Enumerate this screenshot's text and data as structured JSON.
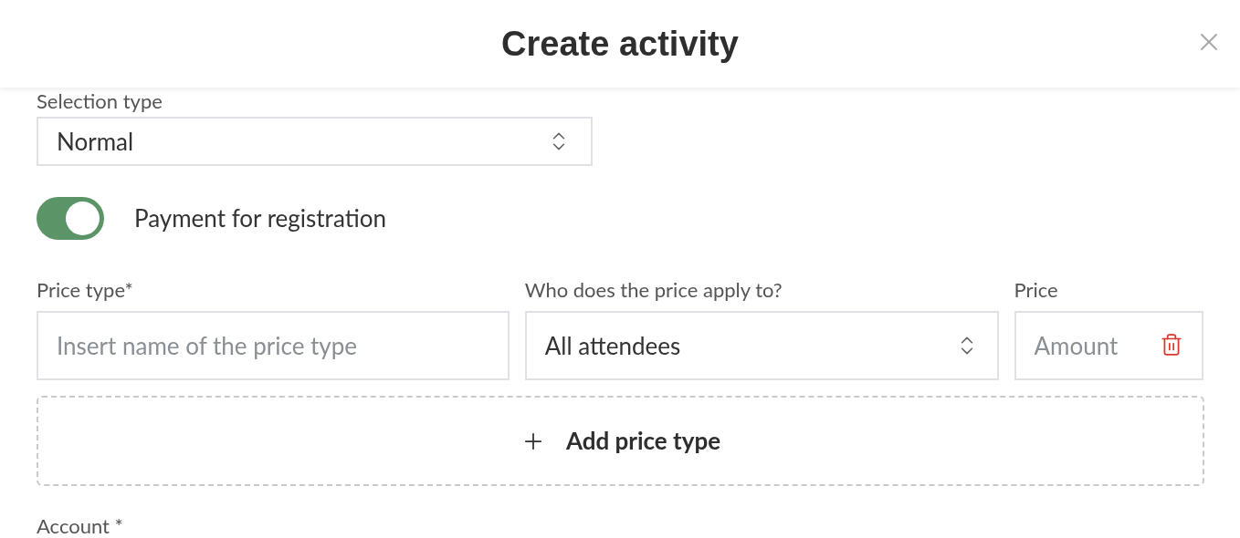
{
  "dialog": {
    "title": "Create activity"
  },
  "selection_type": {
    "label": "Selection type",
    "value": "Normal"
  },
  "payment_toggle": {
    "label": "Payment for registration",
    "on": true
  },
  "price_row": {
    "price_type": {
      "label": "Price type*",
      "placeholder": "Insert name of the price type"
    },
    "applies_to": {
      "label": "Who does the price apply to?",
      "value": "All attendees"
    },
    "price": {
      "label": "Price",
      "placeholder": "Amount"
    }
  },
  "add_button": {
    "label": "Add price type"
  },
  "account": {
    "label": "Account *"
  }
}
